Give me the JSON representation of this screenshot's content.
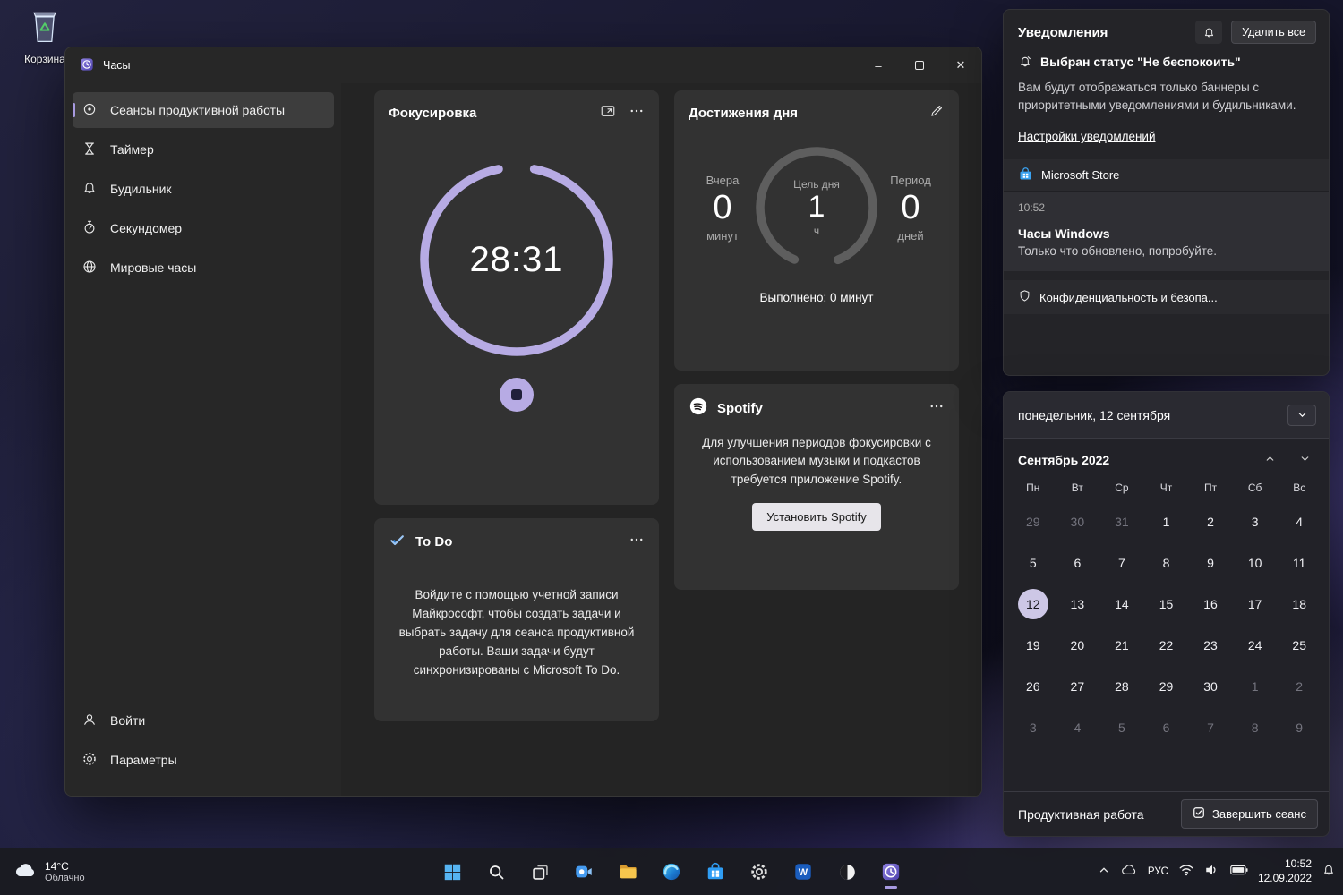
{
  "accent": "#b7abe4",
  "desktop": {
    "recycle_bin": "Корзина"
  },
  "window": {
    "title": "Часы",
    "sidebar": {
      "items": [
        "Сеансы продуктивной работы",
        "Таймер",
        "Будильник",
        "Секундомер",
        "Мировые часы"
      ],
      "signin": "Войти",
      "settings": "Параметры"
    },
    "focus": {
      "title": "Фокусировка",
      "time": "28:31"
    },
    "achievements": {
      "title": "Достижения дня",
      "left_label": "Вчера",
      "left_value": "0",
      "left_unit": "минут",
      "goal_label": "Цель дня",
      "goal_value": "1",
      "goal_unit": "ч",
      "right_label": "Период",
      "right_value": "0",
      "right_unit": "дней",
      "completed": "Выполнено: 0 минут"
    },
    "spotify": {
      "title": "Spotify",
      "body": "Для улучшения периодов фокусировки с использованием музыки и подкастов требуется приложение Spotify.",
      "button": "Установить Spotify"
    },
    "todo": {
      "title": "To Do",
      "body": "Войдите с помощью учетной записи Майкрософт, чтобы создать задачи и выбрать задачу для сеанса продуктивной работы. Ваши задачи будут синхронизированы с Microsoft To Do."
    }
  },
  "notifications": {
    "title": "Уведомления",
    "clear_all": "Удалить все",
    "dnd_title": "Выбран статус \"Не беспокоить\"",
    "dnd_body": "Вам будут отображаться только баннеры с приоритетными уведомлениями и будильниками.",
    "settings_link": "Настройки уведомлений",
    "group_app": "Microsoft Store",
    "item_time": "10:52",
    "item_title": "Часы Windows",
    "item_body": "Только что обновлено, попробуйте.",
    "collapsed": "Конфиденциальность и безопа..."
  },
  "calendar": {
    "header": "понедельник, 12 сентября",
    "month": "Сентябрь 2022",
    "day_names": [
      "Пн",
      "Вт",
      "Ср",
      "Чт",
      "Пт",
      "Сб",
      "Вс"
    ],
    "days": [
      {
        "n": "29",
        "dim": true
      },
      {
        "n": "30",
        "dim": true
      },
      {
        "n": "31",
        "dim": true
      },
      {
        "n": "1"
      },
      {
        "n": "2"
      },
      {
        "n": "3"
      },
      {
        "n": "4"
      },
      {
        "n": "5"
      },
      {
        "n": "6"
      },
      {
        "n": "7"
      },
      {
        "n": "8"
      },
      {
        "n": "9"
      },
      {
        "n": "10"
      },
      {
        "n": "11"
      },
      {
        "n": "12",
        "selected": true
      },
      {
        "n": "13"
      },
      {
        "n": "14"
      },
      {
        "n": "15"
      },
      {
        "n": "16"
      },
      {
        "n": "17"
      },
      {
        "n": "18"
      },
      {
        "n": "19"
      },
      {
        "n": "20"
      },
      {
        "n": "21"
      },
      {
        "n": "22"
      },
      {
        "n": "23"
      },
      {
        "n": "24"
      },
      {
        "n": "25"
      },
      {
        "n": "26"
      },
      {
        "n": "27"
      },
      {
        "n": "28"
      },
      {
        "n": "29"
      },
      {
        "n": "30"
      },
      {
        "n": "1",
        "dim": true
      },
      {
        "n": "2",
        "dim": true
      },
      {
        "n": "3",
        "dim": true
      },
      {
        "n": "4",
        "dim": true
      },
      {
        "n": "5",
        "dim": true
      },
      {
        "n": "6",
        "dim": true
      },
      {
        "n": "7",
        "dim": true
      },
      {
        "n": "8",
        "dim": true
      },
      {
        "n": "9",
        "dim": true
      }
    ],
    "footer_label": "Продуктивная работа",
    "footer_button": "Завершить сеанс"
  },
  "taskbar": {
    "weather_temp": "14°C",
    "weather_desc": "Облачно",
    "language": "РУС",
    "time": "10:52",
    "date": "12.09.2022"
  }
}
